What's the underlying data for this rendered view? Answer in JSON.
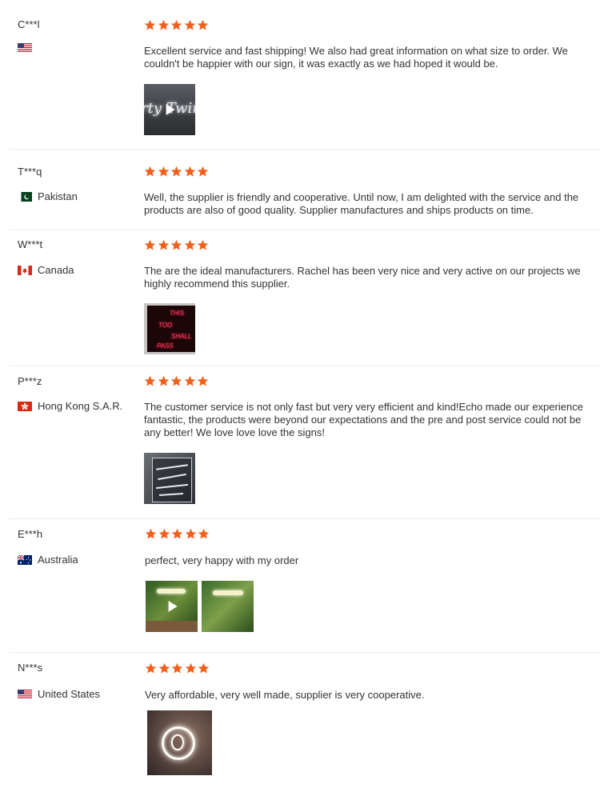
{
  "reviews": [
    {
      "user": "C***l",
      "country": "",
      "flag": "us",
      "text": "Excellent service and fast shipping! We also had great information on what size to order. We couldn't be happier with our sign, it was exactly as we had hoped it would be.",
      "rating": 5
    },
    {
      "user": "T***q",
      "country": "Pakistan",
      "flag": "pk",
      "text": "Well, the supplier is friendly and cooperative. Until now, I am delighted with the service and the products are also of good quality. Supplier manufactures and ships products on time.",
      "rating": 5
    },
    {
      "user": "W***t",
      "country": "Canada",
      "flag": "ca",
      "text": "The are the ideal manufacturers. Rachel has been very nice and very active on our projects we highly recommend this supplier.",
      "rating": 5,
      "thumb_text": [
        "THIS",
        "TOO",
        "SHALL",
        "PASS"
      ]
    },
    {
      "user": "P***z",
      "country": "Hong Kong S.A.R.",
      "flag": "hk",
      "text": "The customer service is not only fast but very very efficient and kind!Echo made our experience fantastic, the products were beyond our expectations and the pre and post service could not be any better! We love love love the signs!",
      "rating": 5
    },
    {
      "user": "E***h",
      "country": "Australia",
      "flag": "au",
      "text": "perfect, very happy with my order",
      "rating": 5
    },
    {
      "user": "N***s",
      "country": "United States",
      "flag": "us",
      "text": "Very affordable, very well made, supplier is very cooperative.",
      "rating": 5
    }
  ],
  "colors": {
    "star": "#f25f1b",
    "text": "#333333",
    "divider": "#ececec"
  }
}
